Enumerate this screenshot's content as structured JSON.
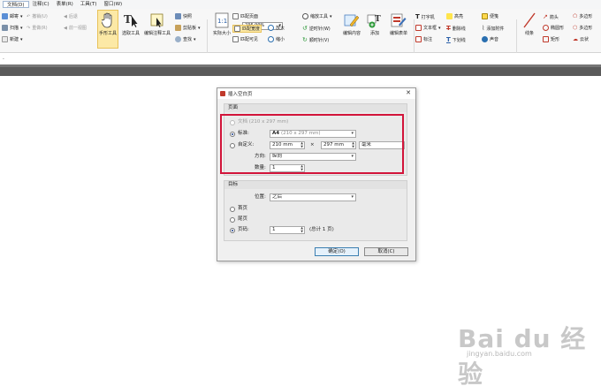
{
  "menu": [
    {
      "label": "文档(D)",
      "active": true
    },
    {
      "label": "注释(C)",
      "active": false
    },
    {
      "label": "表单(R)",
      "active": false
    },
    {
      "label": "工具(T)",
      "active": false
    },
    {
      "label": "窗口(W)",
      "active": false
    }
  ],
  "ribbon": {
    "mail": "邮寄",
    "scan": "扫描",
    "new": "新建",
    "undo": "撤销(U)",
    "redo": "重做(R)",
    "back": "后退",
    "prev_view": "前一视图",
    "hand_tool": "手形工具",
    "select_tool": "选取工具",
    "edit_annot_tool": "编辑注释工具",
    "snapshot": "快照",
    "clipboard": "剪贴板",
    "find": "查找",
    "actual_size": "实际大小",
    "fit_page": "匹配页面",
    "fit_width": "匹配宽度",
    "fit_visible": "匹配可见",
    "zoom_value": "236.99%",
    "zoom_in": "放大",
    "zoom_out": "缩小",
    "zoom_tool": "缩放工具",
    "rotate_cw": "逆时针(W)",
    "rotate_ccw": "顺时针(V)",
    "edit_content": "编辑内容",
    "add": "添加",
    "edit_form": "编辑表单",
    "typewriter": "打字机",
    "textbox": "文本框",
    "callout": "标注",
    "highlight": "高亮",
    "strikeout": "删除线",
    "underline": "下划线",
    "note": "便笺",
    "attach": "添加附件",
    "sound": "声音",
    "line": "线条",
    "arrow": "箭头",
    "ellipse": "椭圆形",
    "rect": "矩形",
    "polygon": "多边形",
    "polyline": "多边形",
    "cloud": "云状",
    "polyline2": "多边形"
  },
  "dialog": {
    "title": "插入空白页",
    "close_symbol": "✕",
    "page_group": "页面",
    "opt_document": "文档",
    "opt_document_size": "(210 x 297 mm)",
    "opt_standard": "标准:",
    "standard_value_bold": "A4",
    "standard_value_tail": "(210 x 297 mm)",
    "opt_custom": "自定义:",
    "custom_width": "210 mm",
    "times": "×",
    "custom_height": "297 mm",
    "unit": "毫米",
    "orientation_label": "方向:",
    "orientation_value": "纵向",
    "count_label": "数量:",
    "count_value": "1",
    "target_group": "目标",
    "position_label": "位置:",
    "position_value": "之后",
    "opt_first": "首页",
    "opt_last": "尾页",
    "opt_page": "页码:",
    "page_value": "1",
    "page_total": "(总计 1 页)",
    "ok": "确定(O)",
    "cancel": "取消(C)",
    "selected_page_option": "标准",
    "selected_target_option": "页码"
  },
  "watermark": {
    "brand": "Bai du 经验",
    "site": "jingyan.baidu.com"
  },
  "colors": {
    "highlight_border": "#d2143a",
    "ribbon_bg": "#f7f7f7",
    "dark_bar": "#5a5a5a"
  }
}
